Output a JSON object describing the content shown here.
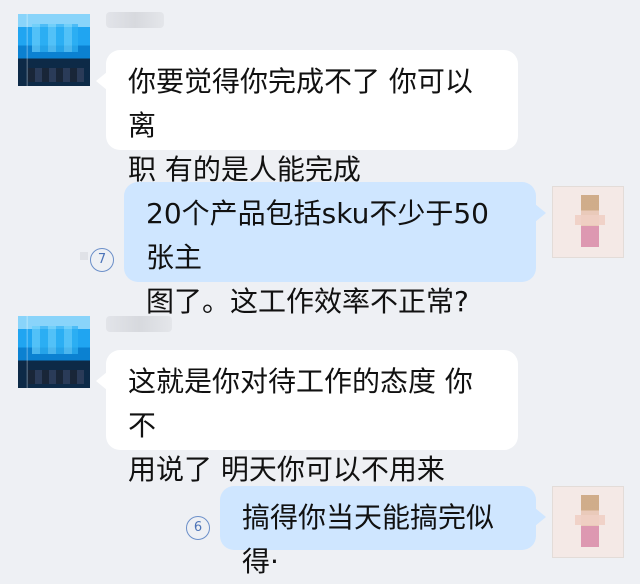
{
  "messages": [
    {
      "side": "left",
      "text": "你要觉得你完成不了 你可以离\n职 有的是人能完成"
    },
    {
      "side": "right",
      "text": "20个产品包括sku不少于50张主\n图了。这工作效率不正常?",
      "read_count": "7"
    },
    {
      "side": "left",
      "text": "这就是你对待工作的态度 你不\n用说了 明天你可以不用来"
    },
    {
      "side": "right",
      "text": "搞得你当天能搞完似得·",
      "read_count": "6"
    }
  ]
}
